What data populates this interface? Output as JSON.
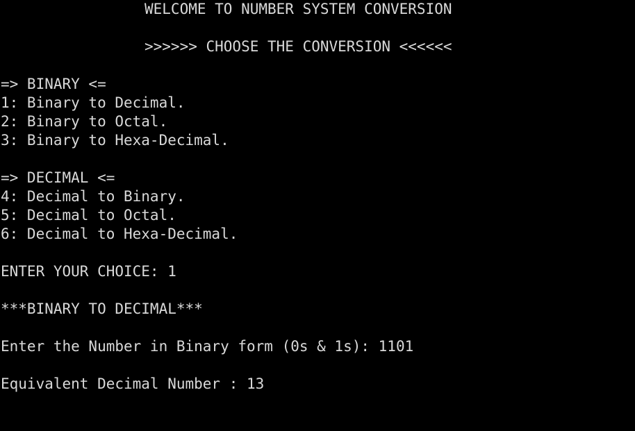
{
  "colors": {
    "background": "#000000",
    "foreground": "#d9d9d9"
  },
  "header": {
    "welcome": "WELCOME TO NUMBER SYSTEM CONVERSION",
    "choose": ">>>>>> CHOOSE THE CONVERSION <<<<<<"
  },
  "menu": {
    "binary_heading": "=> BINARY <=",
    "binary_options": [
      "1: Binary to Decimal.",
      "2: Binary to Octal.",
      "3: Binary to Hexa-Decimal."
    ],
    "decimal_heading": "=> DECIMAL <=",
    "decimal_options": [
      "4: Decimal to Binary.",
      "5: Decimal to Octal.",
      "6: Decimal to Hexa-Decimal."
    ]
  },
  "session": {
    "choice_prompt": "ENTER YOUR CHOICE: ",
    "choice_value": "1",
    "mode_title": "***BINARY TO DECIMAL***",
    "number_prompt": "Enter the Number in Binary form (0s & 1s): ",
    "number_value": "1101",
    "result_label": "Equivalent Decimal Number : ",
    "result_value": "13"
  }
}
